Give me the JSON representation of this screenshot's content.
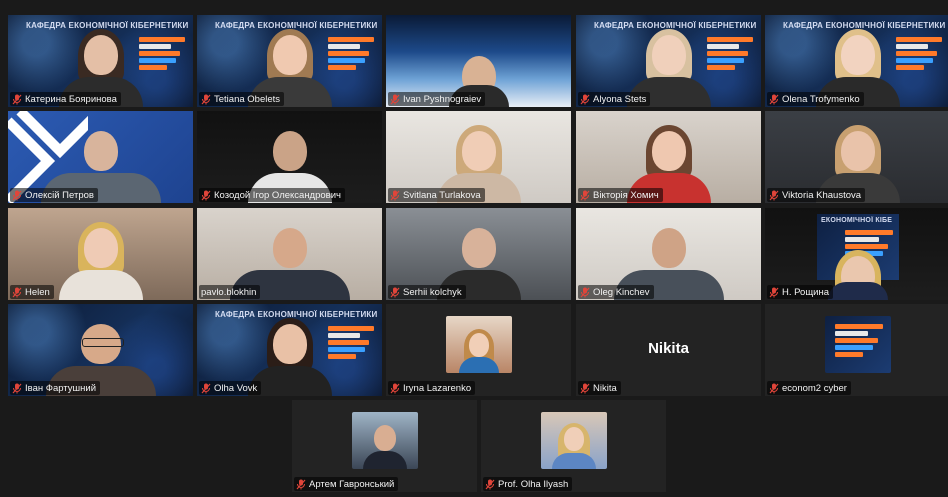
{
  "meeting": {
    "banner_text": "КАФЕДРА ЕКОНОМІЧНОЇ КІБЕРНЕТИКИ",
    "banner_text_short": "ЕКОНОМІЧНОЇ КІБЕ",
    "accent_colors": {
      "active_speaker_border": "#c7e06b",
      "mic_muted": "#e0453a"
    },
    "participants": [
      {
        "name": "Катерина Бояринова",
        "muted": true,
        "background": "cyber"
      },
      {
        "name": "Tetiana Obelets",
        "muted": true,
        "background": "cyber"
      },
      {
        "name": "Ivan Pyshnograiev",
        "muted": true,
        "background": "earth"
      },
      {
        "name": "Alyona Stets",
        "muted": true,
        "background": "cyber"
      },
      {
        "name": "Olena Trofymenko",
        "muted": true,
        "background": "cyber"
      },
      {
        "name": "Олексій Петров",
        "muted": true,
        "background": "blue"
      },
      {
        "name": "Козодой Ігор Олександрович",
        "muted": true,
        "background": "dark"
      },
      {
        "name": "Svitlana Turlakova",
        "muted": true,
        "background": "wall"
      },
      {
        "name": "Вікторія Хомич",
        "muted": true,
        "background": "room"
      },
      {
        "name": "Viktoria Khaustova",
        "muted": true,
        "background": "dim"
      },
      {
        "name": "Helen",
        "muted": true,
        "background": "warm"
      },
      {
        "name": "pavlo.blokhin",
        "muted": false,
        "active_speaker": true,
        "background": "room"
      },
      {
        "name": "Serhii kolchyk",
        "muted": true,
        "background": "office"
      },
      {
        "name": "Oleg Kinchev",
        "muted": true,
        "background": "wall"
      },
      {
        "name": "Н. Рощина",
        "muted": true,
        "background": "dark"
      },
      {
        "name": "Іван Фартушний",
        "muted": true,
        "background": "cyber"
      },
      {
        "name": "Olha Vovk",
        "muted": true,
        "background": "cyber"
      },
      {
        "name": "Iryna Lazarenko",
        "muted": true,
        "background": "plain",
        "avatar": "photo"
      },
      {
        "name": "Nikita",
        "muted": true,
        "background": "plain",
        "display_name": "Nikita"
      },
      {
        "name": "econom2 cyber",
        "muted": true,
        "background": "plain",
        "avatar": "logo"
      },
      {
        "name": "Артем Гавронський",
        "muted": true,
        "background": "plain",
        "avatar": "photo"
      },
      {
        "name": "Prof. Olha Ilyash",
        "muted": true,
        "background": "plain",
        "avatar": "photo"
      }
    ]
  }
}
